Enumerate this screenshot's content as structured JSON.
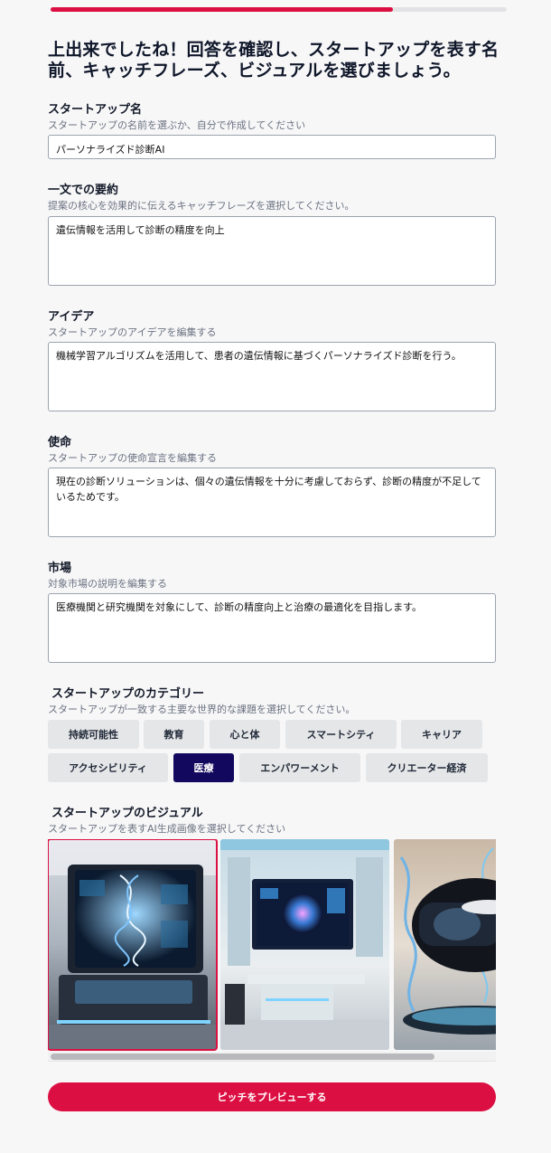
{
  "progress": {
    "fraction": 0.75
  },
  "heading": "上出来でしたね！回答を確認し、スタートアップを表す名前、キャッチフレーズ、ビジュアルを選びましょう。",
  "name_field": {
    "title": "スタートアップ名",
    "subtitle": "スタートアップの名前を選ぶか、自分で作成してください",
    "value": "パーソナライズド診断AI"
  },
  "summary_field": {
    "title": "一文での要約",
    "subtitle": "提案の核心を効果的に伝えるキャッチフレーズを選択してください。",
    "value": "遺伝情報を活用して診断の精度を向上"
  },
  "idea_field": {
    "title": "アイデア",
    "subtitle": "スタートアップのアイデアを編集する",
    "value": "機械学習アルゴリズムを活用して、患者の遺伝情報に基づくパーソナライズド診断を行う。"
  },
  "mission_field": {
    "title": "使命",
    "subtitle": "スタートアップの使命宣言を編集する",
    "value": "現在の診断ソリューションは、個々の遺伝情報を十分に考慮しておらず、診断の精度が不足しているためです。"
  },
  "market_field": {
    "title": "市場",
    "subtitle": "対象市場の説明を編集する",
    "value": "医療機関と研究機関を対象にして、診断の精度向上と治療の最適化を目指します。"
  },
  "category": {
    "title": "スタートアップのカテゴリー",
    "subtitle": "スタートアップが一致する主要な世界的な課題を選択してください。",
    "chips": [
      "持続可能性",
      "教育",
      "心と体",
      "スマートシティ",
      "キャリア",
      "アクセシビリティ",
      "医療",
      "エンパワーメント",
      "クリエーター経済"
    ],
    "selected": "医療"
  },
  "visual": {
    "title": "スタートアップのビジュアル",
    "subtitle": "スタートアップを表すAI生成画像を選択してください"
  },
  "cta_label": "ピッチをプレビューする",
  "colors": {
    "accent": "#dc0f42",
    "selected_chip": "#12095e",
    "chip": "#e5e6e8"
  }
}
